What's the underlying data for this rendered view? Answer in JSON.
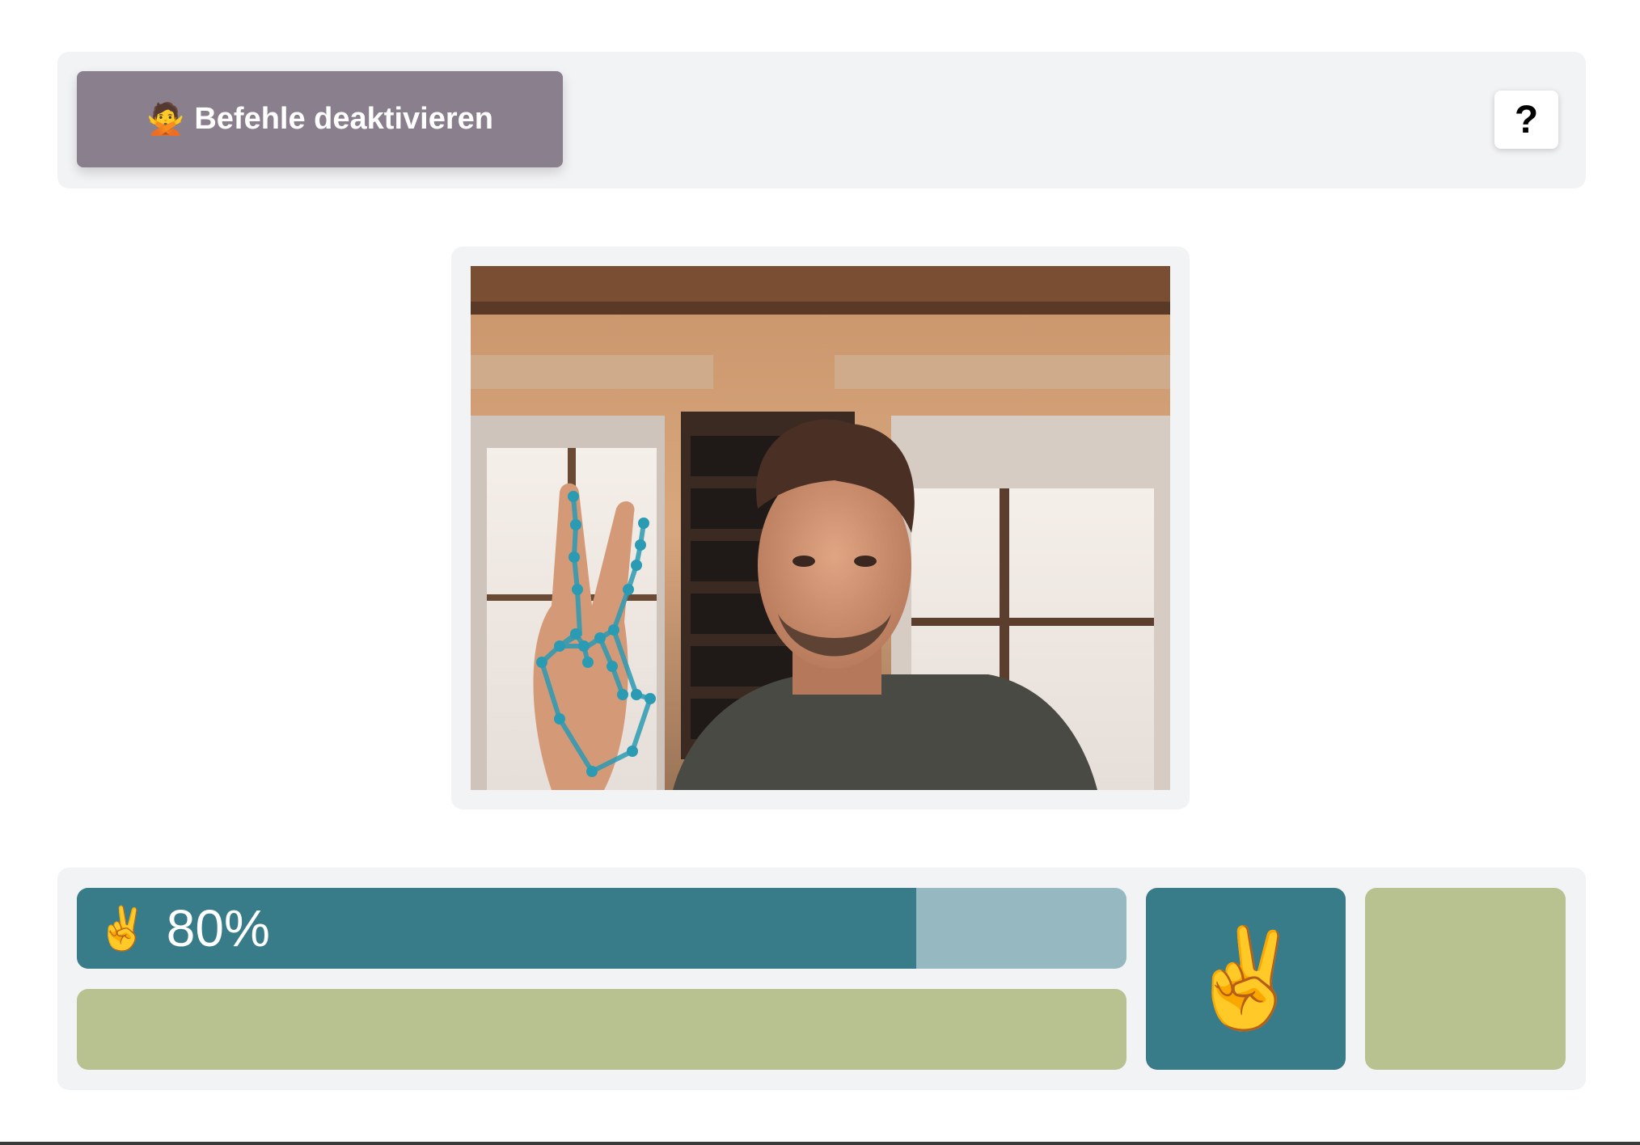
{
  "toolbar": {
    "deactivate_icon": "🙅",
    "deactivate_label": "Befehle deaktivieren",
    "help_label": "?"
  },
  "camera": {
    "feed_description_icon": "webcam-feed-with-hand-landmarks",
    "landmark_color": "#2b9bb3"
  },
  "gesture": {
    "confidence_icon": "✌️",
    "confidence_text": "80%",
    "confidence_value": 0.8,
    "detected_icon": "✌️"
  },
  "colors": {
    "panel_bg": "#f2f3f5",
    "button_bg": "#8a7f8d",
    "bar_fill": "#387c8a",
    "bar_track": "#96b8c0",
    "command_bg": "#b8c190"
  }
}
